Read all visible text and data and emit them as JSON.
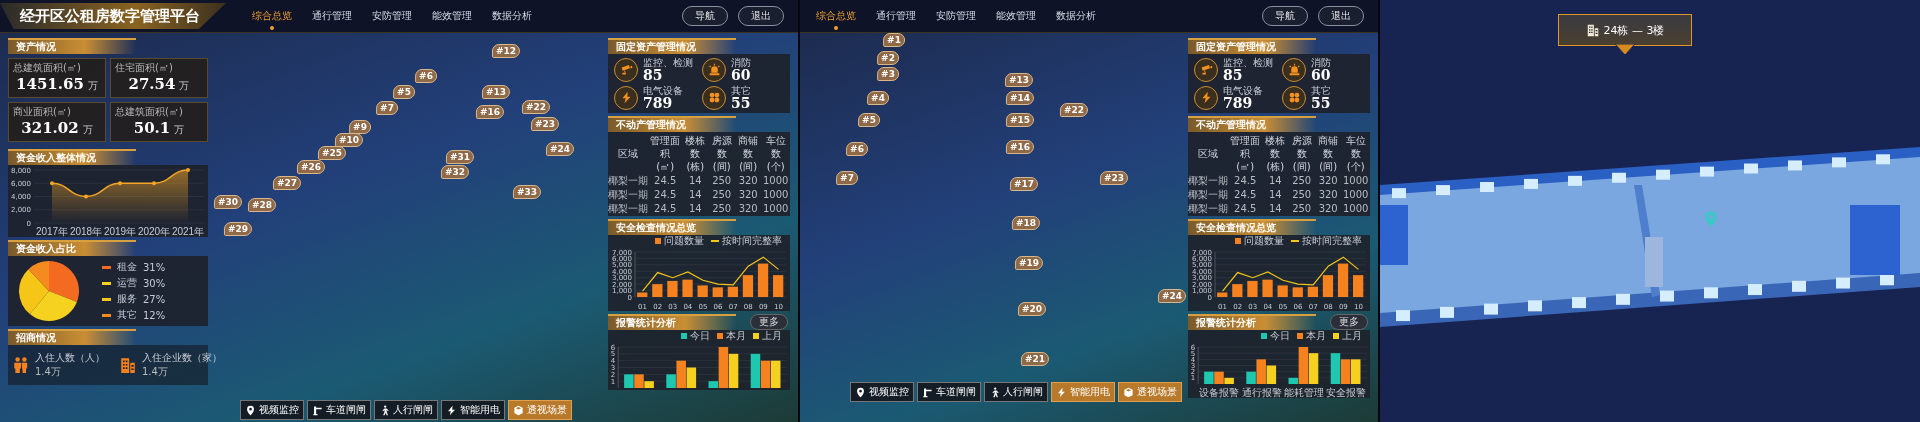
{
  "screens": [
    {
      "kind": "overview",
      "header": {
        "title": "经开区公租房数字管理平台",
        "tabs": [
          {
            "label": "综合总览",
            "selected": true
          },
          {
            "label": "通行管理",
            "selected": false
          },
          {
            "label": "安防管理",
            "selected": false
          },
          {
            "label": "能效管理",
            "selected": false
          },
          {
            "label": "数据分析",
            "selected": false
          }
        ],
        "buttons": [
          "导航",
          "退出"
        ]
      },
      "markers": [
        "#12",
        "#5",
        "#6",
        "#7",
        "#9",
        "#10",
        "#25",
        "#26",
        "#27",
        "#28",
        "#29",
        "#30",
        "#22",
        "#23",
        "#24",
        "#31",
        "#32",
        "#33",
        "#13",
        "#16"
      ],
      "left": {
        "assets": {
          "title": "资产情况",
          "stats": [
            {
              "label": "总建筑面积(㎡)",
              "value": "1451.65",
              "unit": "万"
            },
            {
              "label": "住宅面积(㎡)",
              "value": "27.54",
              "unit": "万"
            },
            {
              "label": "商业面积(㎡)",
              "value": "321.02",
              "unit": "万"
            },
            {
              "label": "总建筑面积(㎡)",
              "value": "50.1",
              "unit": "万"
            }
          ]
        },
        "income": {
          "title": "资金收入整体情况",
          "chart_data": {
            "type": "area",
            "categories": [
              "2017年",
              "2018年",
              "2019年",
              "2020年",
              "2021年"
            ],
            "values": [
              6000,
              4000,
              6000,
              6000,
              8000
            ],
            "ylim": [
              0,
              8000
            ],
            "grid": true,
            "yticks": [
              {
                "value": 0,
                "label": "0"
              },
              {
                "value": 2000,
                "label": "2,000"
              },
              {
                "value": 4000,
                "label": "4,000"
              },
              {
                "value": 6000,
                "label": "6,000"
              },
              {
                "value": 8000,
                "label": "8,000"
              }
            ]
          }
        },
        "share": {
          "title": "资金收入占比",
          "legend": [
            {
              "value": "31%",
              "color": "#f26b21"
            },
            {
              "value": "30%",
              "color": "#f5d21f"
            },
            {
              "value": "27%",
              "color": "#f5c518"
            },
            {
              "value": "12%",
              "color": "#f58a1f"
            }
          ],
          "chart_data": {
            "type": "pie",
            "categories": [
              "租金",
              "运营",
              "服务",
              "其它"
            ],
            "values": [
              31,
              30,
              27,
              12
            ]
          }
        },
        "investment": {
          "title": "招商情况",
          "stats": [
            {
              "label": "入住人数（人）",
              "value": "1.4万"
            },
            {
              "label": "入住企业数（家）",
              "value": "1.4万"
            }
          ]
        }
      },
      "right": {
        "fixed": {
          "title": "固定资产管理情况",
          "items": [
            {
              "label": "监控、检测",
              "value": "85"
            },
            {
              "label": "消防",
              "value": "60"
            },
            {
              "label": "电气设备",
              "value": "789"
            },
            {
              "label": "其它",
              "value": "55"
            }
          ]
        },
        "property": {
          "title": "不动产管理情况",
          "columns": [
            {
              "name": "区域"
            },
            {
              "name": "管理面积",
              "unit": "(㎡)"
            },
            {
              "name": "楼栋数",
              "unit": "(栋)"
            },
            {
              "name": "房源数",
              "unit": "(间)"
            },
            {
              "name": "商铺数",
              "unit": "(间)"
            },
            {
              "name": "车位数",
              "unit": "(个)"
            }
          ],
          "rows": [
            [
              "椰梨一期",
              "24.5",
              "14",
              "250",
              "320",
              "1000"
            ],
            [
              "椰梨一期",
              "24.5",
              "14",
              "250",
              "320",
              "1000"
            ],
            [
              "椰梨一期",
              "24.5",
              "14",
              "250",
              "320",
              "1000"
            ]
          ]
        },
        "safety": {
          "title": "安全检查情况总览",
          "chart_data": {
            "type": "bar",
            "categories": [
              "01",
              "02",
              "03",
              "04",
              "05",
              "06",
              "07",
              "08",
              "09",
              "10"
            ],
            "ylim": [
              0,
              7000
            ],
            "grid": true,
            "legend": "top right",
            "series": [
              {
                "name": "问题数量",
                "type": "bar",
                "color": "#f5821f",
                "values": [
                  700,
                  2000,
                  2500,
                  2700,
                  1800,
                  1500,
                  1600,
                  3400,
                  5200,
                  3400
                ]
              },
              {
                "name": "按时间完整率",
                "type": "line",
                "color": "#f5c518",
                "values": [
                  900,
                  3800,
                  3000,
                  3900,
                  2600,
                  2000,
                  1900,
                  4800,
                  6200,
                  4300
                ]
              }
            ],
            "yticks": [
              {
                "value": 0,
                "label": "0"
              },
              {
                "value": 1000,
                "label": "1,000"
              },
              {
                "value": 2000,
                "label": "2,000"
              },
              {
                "value": 3000,
                "label": "3,000"
              },
              {
                "value": 4000,
                "label": "4,000"
              },
              {
                "value": 5000,
                "label": "5,000"
              },
              {
                "value": 6000,
                "label": "6,000"
              },
              {
                "value": 7000,
                "label": "7,000"
              }
            ]
          }
        },
        "alarm": {
          "title": "报警统计分析",
          "button": "更多",
          "chart_data": {
            "type": "bar",
            "categories": [
              null,
              null,
              null,
              null
            ],
            "ylim": [
              0,
              6
            ],
            "grid": true,
            "legend": "top right",
            "series": [
              {
                "name": "今日",
                "type": "bar",
                "color": "#1ec8b0",
                "values": [
                  2,
                  2,
                  1,
                  5
                ]
              },
              {
                "name": "本月",
                "type": "bar",
                "color": "#f5821f",
                "values": [
                  2,
                  4,
                  6,
                  4
                ]
              },
              {
                "name": "上月",
                "type": "bar",
                "color": "#f5d020",
                "values": [
                  1,
                  3,
                  5,
                  4
                ]
              }
            ],
            "yticks": [
              1,
              2,
              3,
              4,
              5,
              6
            ]
          }
        }
      },
      "toolbar": [
        {
          "label": "视频监控",
          "selected": false
        },
        {
          "label": "车道闸闸",
          "selected": false
        },
        {
          "label": "人行闸闸",
          "selected": false
        },
        {
          "label": "智能用电",
          "selected": false
        },
        {
          "label": "透视场景",
          "selected": true
        }
      ]
    },
    {
      "kind": "overview",
      "header": {
        "tabs": [
          {
            "label": "综合总览",
            "selected": true
          },
          {
            "label": "通行管理",
            "selected": false
          },
          {
            "label": "安防管理",
            "selected": false
          },
          {
            "label": "能效管理",
            "selected": false
          },
          {
            "label": "数据分析",
            "selected": false
          }
        ],
        "buttons": [
          "导航",
          "退出"
        ]
      },
      "markers": [
        "#1",
        "#2",
        "#3",
        "#4",
        "#5",
        "#6",
        "#7",
        "#13",
        "#14",
        "#15",
        "#16",
        "#17",
        "#18",
        "#19",
        "#20",
        "#21",
        "#22",
        "#23",
        "#24"
      ],
      "right": {
        "fixed": {
          "title": "固定资产管理情况",
          "items": [
            {
              "label": "监控、检测",
              "value": "85"
            },
            {
              "label": "消防",
              "value": "60"
            },
            {
              "label": "电气设备",
              "value": "789"
            },
            {
              "label": "其它",
              "value": "55"
            }
          ]
        },
        "property": {
          "title": "不动产管理情况",
          "columns": [
            {
              "name": "区域"
            },
            {
              "name": "管理面积",
              "unit": "(㎡)"
            },
            {
              "name": "楼栋数",
              "unit": "(栋)"
            },
            {
              "name": "房源数",
              "unit": "(间)"
            },
            {
              "name": "商铺数",
              "unit": "(间)"
            },
            {
              "name": "车位数",
              "unit": "(个)"
            }
          ],
          "rows": [
            [
              "椰梨一期",
              "24.5",
              "14",
              "250",
              "320",
              "1000"
            ],
            [
              "椰梨一期",
              "24.5",
              "14",
              "250",
              "320",
              "1000"
            ],
            [
              "椰梨一期",
              "24.5",
              "14",
              "250",
              "320",
              "1000"
            ]
          ]
        },
        "safety": {
          "title": "安全检查情况总览",
          "chart_data": {
            "type": "bar",
            "categories": [
              "01",
              "02",
              "03",
              "04",
              "05",
              "06",
              "07",
              "08",
              "09",
              "10"
            ],
            "ylim": [
              0,
              7000
            ],
            "grid": true,
            "legend": "top right",
            "series": [
              {
                "name": "问题数量",
                "type": "bar",
                "color": "#f5821f",
                "values": [
                  700,
                  2000,
                  2500,
                  2700,
                  1800,
                  1500,
                  1600,
                  3400,
                  5200,
                  3400
                ]
              },
              {
                "name": "按时间完整率",
                "type": "line",
                "color": "#f5c518",
                "values": [
                  900,
                  3800,
                  3000,
                  3900,
                  2600,
                  2000,
                  1900,
                  4800,
                  6200,
                  4300
                ]
              }
            ],
            "yticks": [
              {
                "value": 0,
                "label": "0"
              },
              {
                "value": 1000,
                "label": "1,000"
              },
              {
                "value": 2000,
                "label": "2,000"
              },
              {
                "value": 3000,
                "label": "3,000"
              },
              {
                "value": 4000,
                "label": "4,000"
              },
              {
                "value": 5000,
                "label": "5,000"
              },
              {
                "value": 6000,
                "label": "6,000"
              },
              {
                "value": 7000,
                "label": "7,000"
              }
            ]
          }
        },
        "alarm": {
          "title": "报警统计分析",
          "button": "更多",
          "chart_data": {
            "type": "bar",
            "categories": [
              "设备报警",
              "通行报警",
              "能耗管理",
              "安全报警"
            ],
            "ylim": [
              0,
              6
            ],
            "yticks": [
              1,
              2,
              3,
              4,
              5,
              6
            ],
            "grid": true,
            "legend": "top right",
            "series": [
              {
                "name": "今日",
                "type": "bar",
                "color": "#1ec8b0",
                "values": [
                  2,
                  2,
                  1,
                  5
                ]
              },
              {
                "name": "本月",
                "type": "bar",
                "color": "#f5821f",
                "values": [
                  2,
                  4,
                  6,
                  4
                ]
              },
              {
                "name": "上月",
                "type": "bar",
                "color": "#f5d020",
                "values": [
                  1,
                  3,
                  5,
                  4
                ]
              }
            ]
          }
        }
      },
      "toolbar": [
        {
          "label": "视频监控",
          "selected": false
        },
        {
          "label": "车道闸闸",
          "selected": false
        },
        {
          "label": "人行闸闸",
          "selected": false
        },
        {
          "label": "智能用电",
          "selected": true
        },
        {
          "label": "透视场景",
          "selected": true
        }
      ]
    },
    {
      "kind": "floor",
      "tooltip": "24栋 — 3楼"
    }
  ]
}
